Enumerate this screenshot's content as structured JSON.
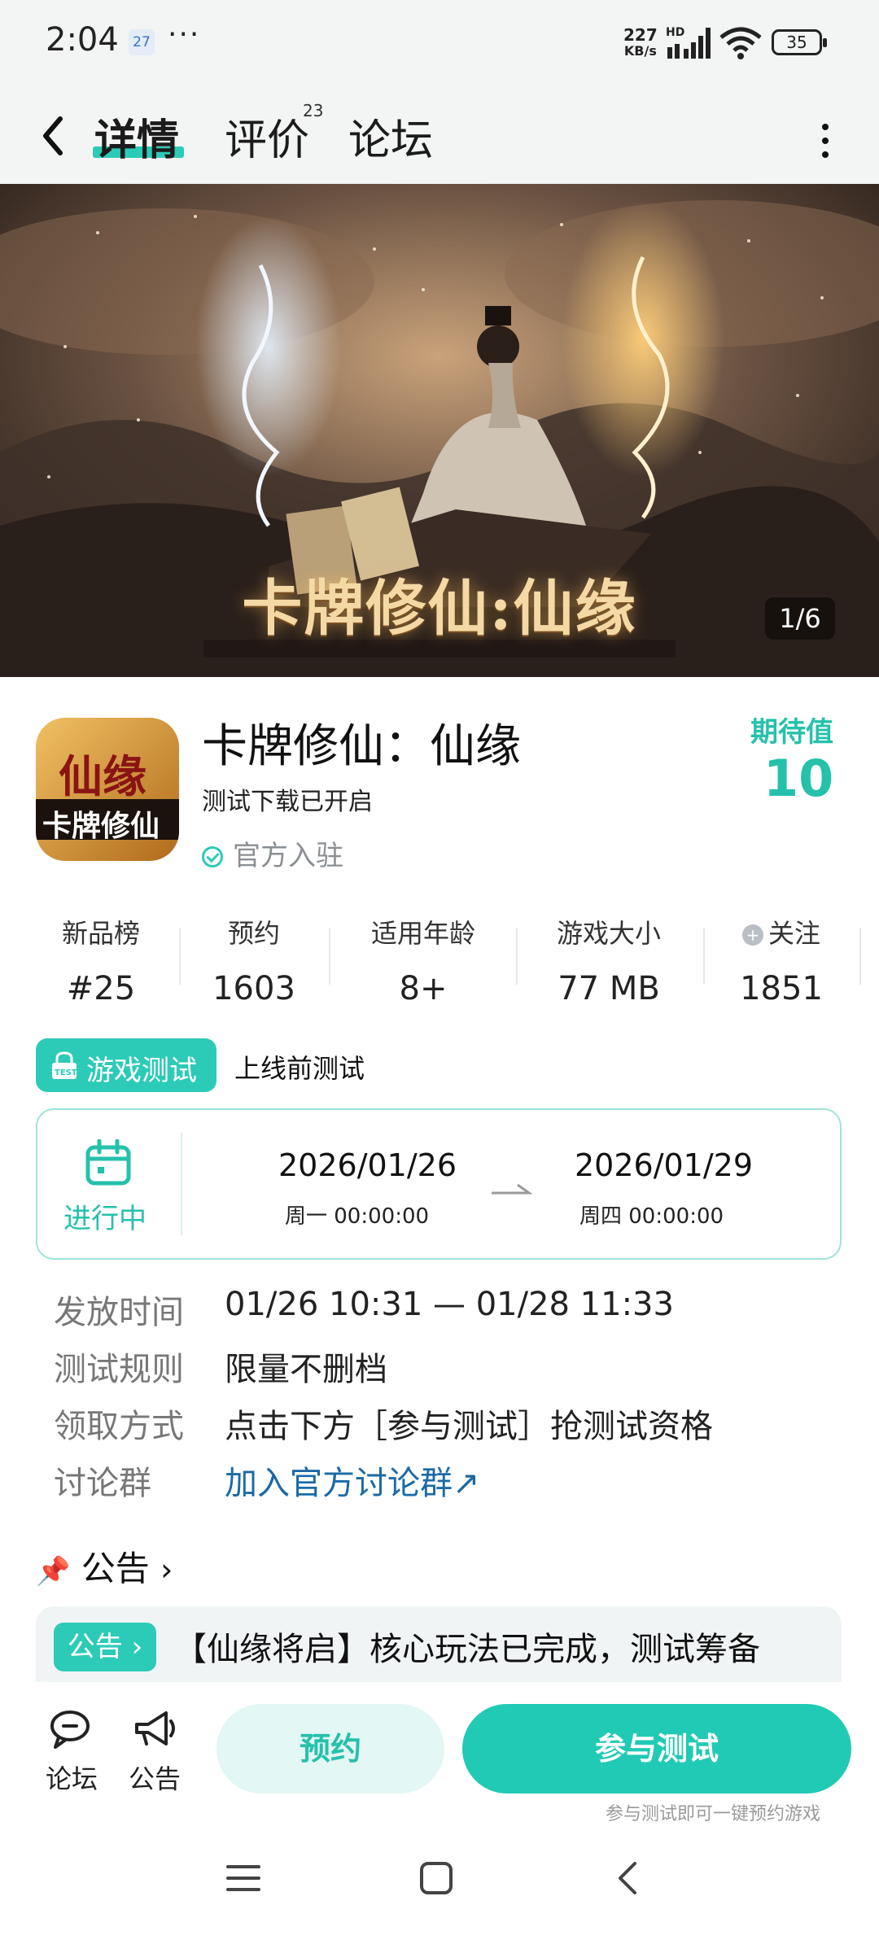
{
  "status_bar": {
    "time": "2:04",
    "notification": "27",
    "more": "···",
    "net_speed_value": "227",
    "net_speed_unit": "KB/s",
    "hd": "HD",
    "battery": "35"
  },
  "nav": {
    "tabs": [
      {
        "label": "详情"
      },
      {
        "label": "评价"
      },
      {
        "label": "论坛"
      }
    ],
    "review_count": "23"
  },
  "banner": {
    "title": "卡牌修仙:仙缘",
    "counter": "1/6"
  },
  "app": {
    "name": "卡牌修仙：仙缘",
    "subtitle": "测试下载已开启",
    "official": "官方入驻",
    "icon_text_top": "仙缘",
    "icon_text_bottom": "卡牌修仙",
    "expect_label": "期待值",
    "expect_value": "10"
  },
  "stats": [
    {
      "label": "新品榜",
      "value": "#25"
    },
    {
      "label": "预约",
      "value": "1603"
    },
    {
      "label": "适用年龄",
      "value": "8+"
    },
    {
      "label": "游戏大小",
      "value": "77 MB"
    },
    {
      "label": "关注",
      "value": "1851"
    }
  ],
  "test": {
    "badge": "游戏测试",
    "type": "上线前测试",
    "status": "进行中",
    "start_date": "2026/01/26",
    "start_time": "周一  00:00:00",
    "end_date": "2026/01/29",
    "end_time": "周四  00:00:00"
  },
  "info": [
    {
      "key": "发放时间",
      "value": "01/26 10:31 — 01/28 11:33"
    },
    {
      "key": "测试规则",
      "value": "限量不删档"
    },
    {
      "key": "领取方式",
      "value": "点击下方［参与测试］抢测试资格"
    },
    {
      "key": "讨论群",
      "value": "加入官方讨论群↗"
    }
  ],
  "notice": {
    "heading": "公告",
    "tag": "公告",
    "text": "【仙缘将启】核心玩法已完成，测试筹备"
  },
  "bottom": {
    "forum": "论坛",
    "announcement": "公告",
    "reserve": "预约",
    "join": "参与测试",
    "join_hint": "参与测试即可一键预约游戏"
  },
  "colors": {
    "accent": "#2ccbb7",
    "link": "#1b6aa6"
  }
}
